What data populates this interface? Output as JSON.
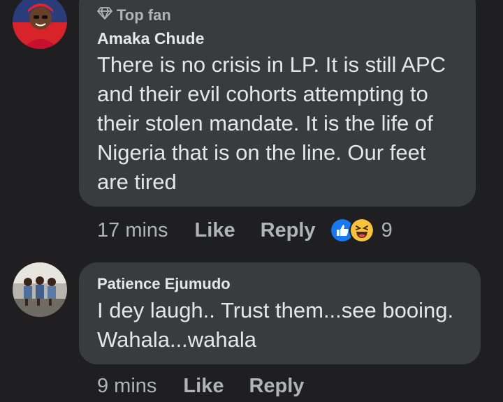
{
  "comments": [
    {
      "badge": "Top fan",
      "author": "Amaka Chude",
      "text": "There is no crisis in LP. It is still APC\nand their evil cohorts attempting to\ntheir stolen mandate. It is the life of\nNigeria that is on the line.  Our feet\nare tired",
      "time": "17 mins",
      "like_label": "Like",
      "reply_label": "Reply",
      "reaction_count": "9",
      "reactions": [
        "like-icon",
        "haha-icon"
      ]
    },
    {
      "author": "Patience Ejumudo",
      "text": "I dey laugh.. Trust them...see booing.\nWahala...wahala",
      "time": "9 mins",
      "like_label": "Like",
      "reply_label": "Reply"
    }
  ],
  "colors": {
    "background": "#1f1f21",
    "bubble": "#3a3b3c",
    "text": "#e4e6eb",
    "muted": "#b0b3b8",
    "like_blue": "#1877f2",
    "haha_yellow": "#f7c33b"
  }
}
